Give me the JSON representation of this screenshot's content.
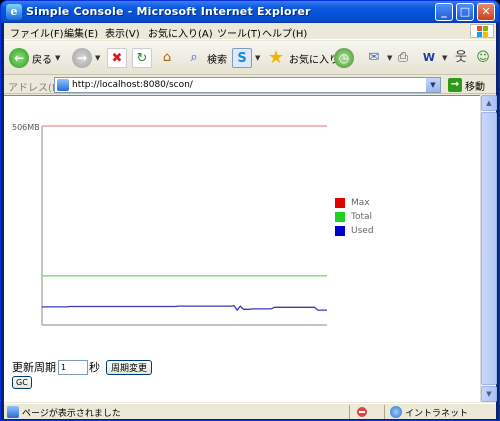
{
  "window": {
    "title": "Simple Console - Microsoft Internet Explorer",
    "app_icon": "ie-icon"
  },
  "menu": [
    "ファイル(F)",
    "編集(E)",
    "表示(V)",
    "お気に入り(A)",
    "ツール(T)",
    "ヘルプ(H)"
  ],
  "toolbar": {
    "back_label": "戻る",
    "search_label": "検索",
    "favorites_label": "お気に入り"
  },
  "address": {
    "label": "アドレス(D)",
    "url": "http://localhost:8080/scon/",
    "go_label": "移動"
  },
  "chart_data": {
    "type": "line",
    "y_axis_top_label": "506MB",
    "ylim": [
      0,
      506
    ],
    "series": [
      {
        "name": "Max",
        "color": "#f2a0a0",
        "legend_color": "#e00000",
        "values": [
          506,
          506,
          506,
          506,
          506,
          506,
          506,
          506,
          506,
          506,
          506,
          506,
          506,
          506,
          506,
          506,
          506,
          506,
          506,
          506,
          506,
          506,
          506,
          506,
          506,
          506,
          506,
          506,
          506,
          506
        ]
      },
      {
        "name": "Total",
        "color": "#86e08a",
        "legend_color": "#22d022",
        "values": [
          125,
          125,
          125,
          125,
          125,
          125,
          125,
          125,
          125,
          125,
          125,
          125,
          125,
          125,
          125,
          125,
          125,
          125,
          125,
          125,
          125,
          125,
          125,
          125,
          125,
          125,
          125,
          125,
          125,
          125
        ]
      },
      {
        "name": "Used",
        "color": "#3a3ab8",
        "legend_color": "#0000cc",
        "values": [
          46,
          46,
          46,
          46,
          46,
          46,
          46,
          46,
          46,
          47,
          47,
          47,
          47,
          47,
          47,
          47,
          47,
          47,
          47,
          47,
          47,
          47,
          47,
          47,
          47,
          47,
          47,
          47,
          47,
          47,
          47,
          47,
          47,
          47,
          47,
          47,
          47,
          47,
          47,
          47,
          47,
          47,
          47,
          47,
          48,
          48,
          48,
          48,
          48,
          48,
          48,
          48,
          48,
          48,
          48,
          48,
          48,
          48,
          48,
          48,
          48,
          48,
          49,
          38,
          48,
          40,
          40,
          40,
          41,
          41,
          41,
          41,
          41,
          41,
          41,
          45,
          45,
          45,
          45,
          45,
          45,
          45,
          45,
          45,
          45,
          45,
          45,
          45,
          45,
          38,
          38,
          38,
          38
        ]
      }
    ],
    "legend_position": "right"
  },
  "controls": {
    "interval_label": "更新周期",
    "interval_value": "1",
    "interval_unit": "秒",
    "change_button": "周期変更",
    "gc_button": "GC"
  },
  "status": {
    "text": "ページが表示されました",
    "zone": "イントラネット"
  }
}
